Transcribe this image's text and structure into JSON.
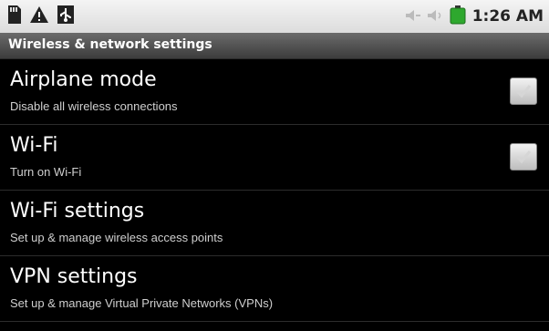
{
  "status_bar": {
    "time": "1:26 AM",
    "icons": [
      "sd-card-icon",
      "warning-icon",
      "usb-icon",
      "sound-off-icon",
      "sound-icon",
      "battery-icon"
    ]
  },
  "screen": {
    "title": "Wireless & network settings"
  },
  "settings": [
    {
      "title": "Airplane mode",
      "summary": "Disable all wireless connections",
      "checkbox": true
    },
    {
      "title": "Wi-Fi",
      "summary": "Turn on Wi-Fi",
      "checkbox": true
    },
    {
      "title": "Wi-Fi settings",
      "summary": "Set up & manage wireless access points",
      "checkbox": false
    },
    {
      "title": "VPN settings",
      "summary": "Set up & manage Virtual Private Networks (VPNs)",
      "checkbox": false
    }
  ],
  "colors": {
    "background": "#000000",
    "statusbar": "#e8e8e8",
    "titlebar": "#555555",
    "battery": "#2ea82e"
  }
}
